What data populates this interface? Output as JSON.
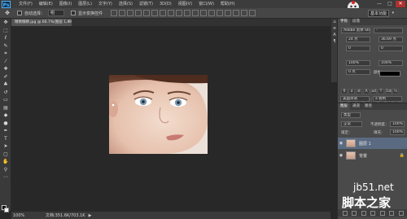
{
  "app": {
    "logo": "Ps",
    "menu": [
      "文件(F)",
      "编辑(E)",
      "图像(I)",
      "图层(L)",
      "文字(Y)",
      "选择(S)",
      "滤镜(T)",
      "3D(D)",
      "视图(V)",
      "窗口(W)",
      "帮助(H)"
    ],
    "window_controls": {
      "minimize": "—",
      "maximize": "□",
      "close": "✕"
    }
  },
  "options": {
    "auto_select_label": "自动选择：",
    "auto_select_value": "组",
    "show_transform_label": "显示变换控件",
    "workspace": "基本功能"
  },
  "document": {
    "tab_title": "精致眼睛.jpg @ 66.7%(图层 1, RGB/8#) *",
    "tab_close": "×"
  },
  "status": {
    "zoom": "100%",
    "doc_info": "文档:351.6K/703.1K",
    "arrow": "▶"
  },
  "character_panel": {
    "tabs": [
      "字符",
      "段落"
    ],
    "font_family": "Adobe 黑体 Std",
    "font_style": "-",
    "font_size": "24 点",
    "leading": "36.69 点",
    "kerning": "0",
    "tracking": "0",
    "scale_v": "100%",
    "scale_h": "100%",
    "baseline": "0 点",
    "color_label": "颜色：",
    "style_buttons": [
      "T",
      "T",
      "TT",
      "Tr",
      "T",
      "T,",
      "T",
      "T"
    ],
    "opentype_buttons": [
      "fi",
      "σ",
      "st",
      "A",
      "ad",
      "T",
      "1st",
      "½"
    ],
    "language": "美国英语",
    "antialias": "a 锐利"
  },
  "layers_panel": {
    "tabs": [
      "图层",
      "通道",
      "路径"
    ],
    "filter_label": "类型",
    "blend_mode": "正常",
    "opacity_label": "不透明度：",
    "opacity": "100%",
    "lock_label": "锁定：",
    "fill_label": "填充：",
    "fill": "100%",
    "layers": [
      {
        "name": "图层 1",
        "selected": true
      },
      {
        "name": "背景",
        "selected": false
      }
    ]
  },
  "watermark": {
    "site": "jb51.net",
    "cn": "脚本之家"
  }
}
